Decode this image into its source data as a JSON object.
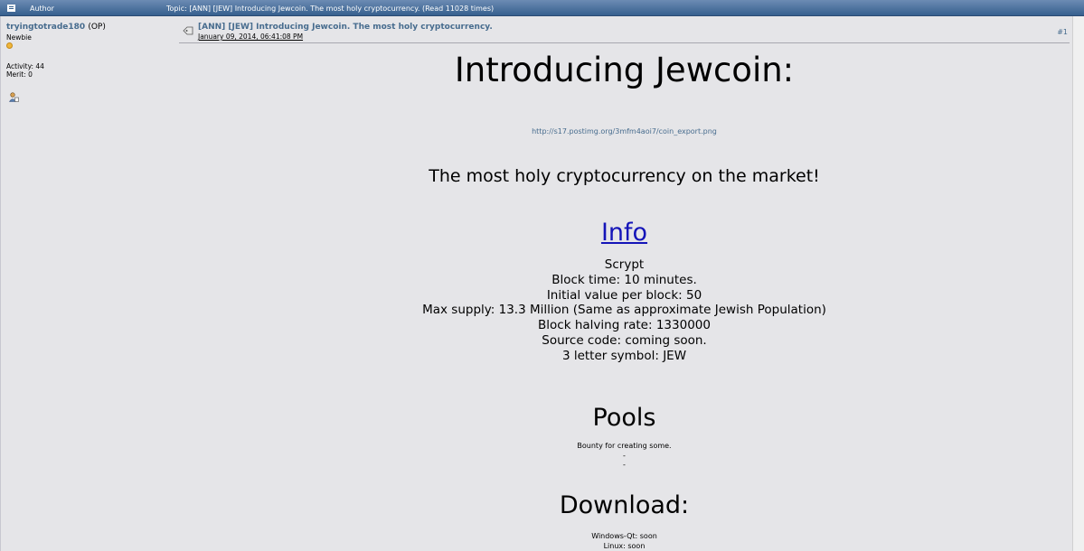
{
  "header": {
    "author_label": "Author",
    "topic_label": "Topic: [ANN] [JEW] Introducing Jewcoin. The most holy cryptocurrency.  (Read 11028 times)"
  },
  "poster": {
    "name": "tryingtotrade180",
    "op": "(OP)",
    "rank": "Newbie",
    "activity": "Activity: 44",
    "merit": "Merit: 0"
  },
  "post": {
    "subject": "[ANN] [JEW] Introducing Jewcoin. The most holy cryptocurrency.",
    "date": "January 09, 2014, 06:41:08 PM",
    "number": "#1",
    "title": "Introducing Jewcoin:",
    "image_link": "http://s17.postimg.org/3mfm4aoi7/coin_export.png",
    "tagline": "The most holy cryptocurrency on the market!",
    "info_heading": "Info",
    "specs": [
      "Scrypt",
      "Block time: 10 minutes.",
      "Initial value per block: 50",
      "Max supply: 13.3 Million (Same as approximate Jewish Population)",
      "Block halving rate: 1330000",
      "Source code: coming soon.",
      "3 letter symbol: JEW"
    ],
    "pools_heading": "Pools",
    "pools_lines": [
      "Bounty for creating some.",
      "-",
      "-"
    ],
    "download_heading": "Download:",
    "download_lines": [
      "Windows-Qt: soon",
      "Linux: soon"
    ]
  }
}
